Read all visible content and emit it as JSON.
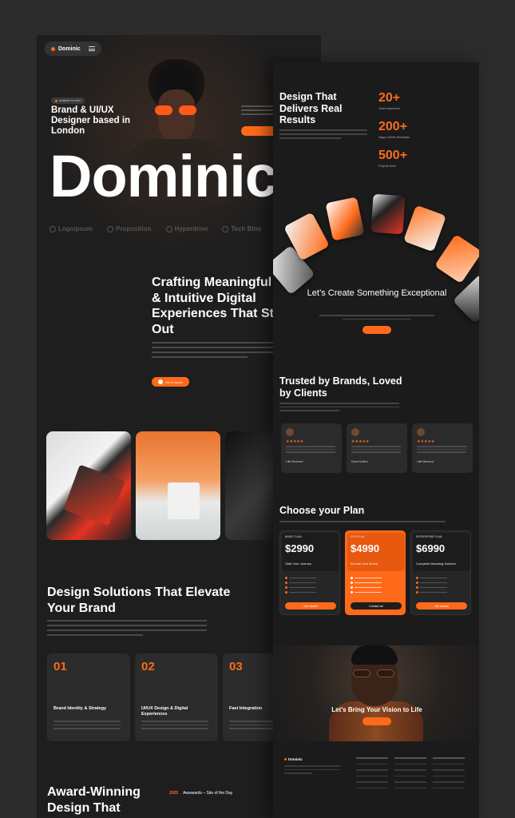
{
  "left": {
    "brand_chip": "Dominic",
    "hero_pill": "available for work",
    "hero_tagline": "Brand & UI/UX Designer based in London",
    "big_name": "Dominic",
    "logos": [
      "Logoipsum",
      "Proposition",
      "Hyperdrive",
      "Tech Blox",
      "..."
    ],
    "crafting_heading": "Crafting Meaningful Brands & Intuitive Digital Experiences That Stand Out",
    "cta_button": "Get in touch",
    "solutions_heading": "Design Solutions That Elevate Your Brand",
    "services": [
      {
        "num": "01",
        "title": "Brand Identity & Strategy"
      },
      {
        "num": "02",
        "title": "UI/UX Design & Digital Experiences"
      },
      {
        "num": "03",
        "title": "Fast Integration"
      }
    ],
    "award_heading": "Award-Winning Design That",
    "award_year": "2025",
    "award_item": "Awwwards – Site of the Day"
  },
  "right": {
    "results_heading": "Design That Delivers Real Results",
    "stats": [
      {
        "value": "20+",
        "label": "Years experience"
      },
      {
        "value": "200+",
        "label": "Happy Clients Worldwide"
      },
      {
        "value": "500+",
        "label": "Projects Done"
      }
    ],
    "create_heading": "Let’s Create Something Exceptional",
    "trusted_heading": "Trusted by Brands, Loved by Clients",
    "reviews": [
      {
        "stars": "★★★★★",
        "name": "Lillie Bertrand"
      },
      {
        "stars": "★★★★★",
        "name": "David Mollins"
      },
      {
        "stars": "★★★★★",
        "name": "Lillie Bertrand"
      }
    ],
    "plans_heading": "Choose your Plan",
    "plans": [
      {
        "name": "BASIC PLAN",
        "price": "$2990",
        "desc": "Start Your Journey",
        "button": "Get started"
      },
      {
        "name": "PRO PLAN",
        "price": "$4990",
        "desc": "Elevate Your Brand",
        "button": "Contact me"
      },
      {
        "name": "ENTERPRISE PLAN",
        "price": "$6990",
        "desc": "Complete Branding Solution",
        "button": "Get started"
      }
    ],
    "vision_heading": "Let’s Bring Your Vision to Life",
    "footer_brand": "Dominic"
  },
  "colors": {
    "accent": "#ff6a1a",
    "bg": "#1d1d1d",
    "page": "#2b2b2b"
  }
}
